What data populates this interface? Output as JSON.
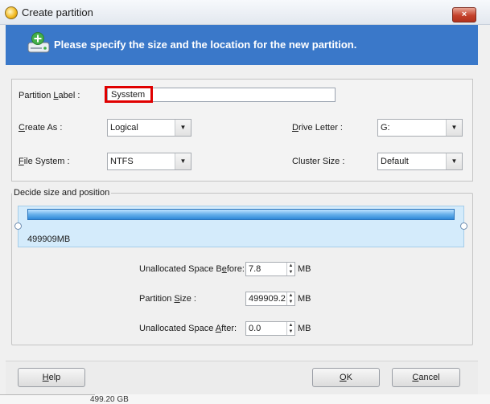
{
  "window": {
    "title": "Create partition",
    "close_glyph": "×"
  },
  "banner": {
    "text": "Please specify the size and the location for the new partition."
  },
  "fields": {
    "partition_label": {
      "pre": "Partition ",
      "key": "L",
      "post": "abel :",
      "value": "Sysstem"
    },
    "create_as": {
      "key": "C",
      "post": "reate As :",
      "value": "Logical"
    },
    "drive_letter": {
      "key": "D",
      "post": "rive Letter :",
      "value": "G:"
    },
    "file_system": {
      "key": "F",
      "post": "ile System :",
      "value": "NTFS"
    },
    "cluster_size": {
      "label": "Cluster Size :",
      "value": "Default"
    }
  },
  "size_group": {
    "title": "Decide size and position",
    "bar_size": "499909MB",
    "unallocated_before": {
      "pre": "Unallocated Space B",
      "key": "e",
      "post": "fore:",
      "value": "7.8",
      "unit": "MB"
    },
    "partition_size": {
      "pre": "Partition ",
      "key": "S",
      "post": "ize :",
      "value": "499909.2",
      "unit": "MB"
    },
    "unallocated_after": {
      "pre": "Unallocated Space ",
      "key": "A",
      "post": "fter:",
      "value": "0.0",
      "unit": "MB"
    }
  },
  "footer": {
    "help": {
      "key": "H",
      "post": "elp"
    },
    "ok": {
      "key": "O",
      "post": "K"
    },
    "cancel": {
      "key": "C",
      "post": "ancel"
    }
  },
  "icons": {
    "app": "app-star-icon",
    "banner": "disk-add-icon",
    "dropdown": "chevron-down-icon",
    "spin_up": "▲",
    "spin_down": "▼"
  },
  "background_text": "499.20 GB"
}
